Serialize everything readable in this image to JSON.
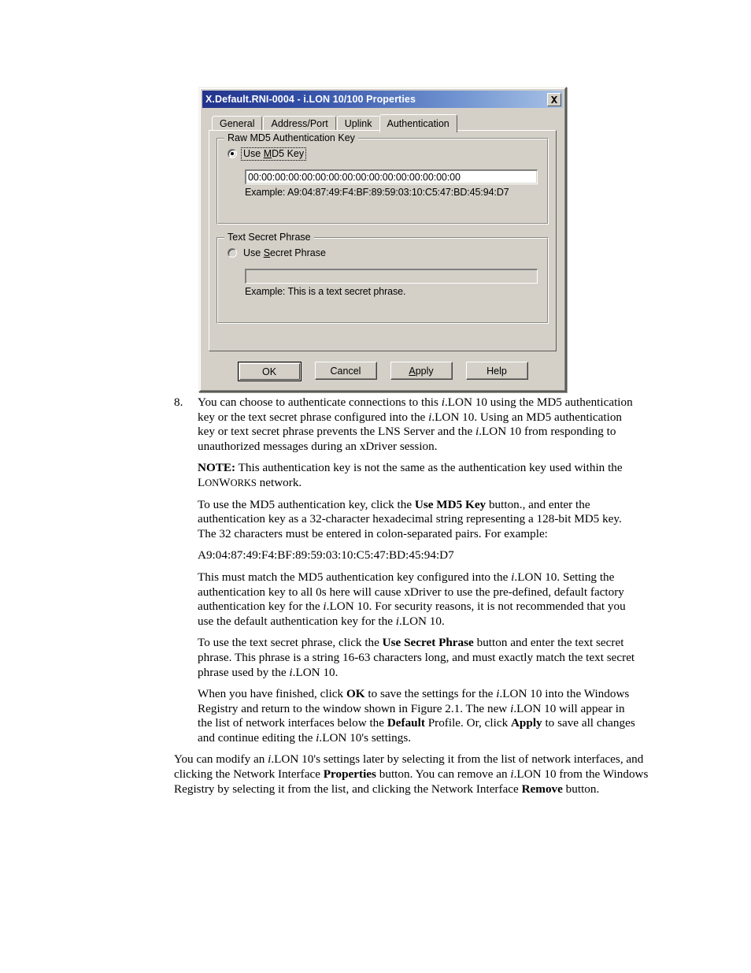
{
  "dialog": {
    "title": "X.Default.RNI-0004 - i.LON 10/100 Properties",
    "close_icon": "close-icon",
    "tabs": [
      {
        "label": "General",
        "active": false
      },
      {
        "label": "Address/Port",
        "active": false
      },
      {
        "label": "Uplink",
        "active": false
      },
      {
        "label": "Authentication",
        "active": true
      }
    ],
    "md5_group": {
      "title": "Raw MD5 Authentication Key",
      "radio_label_pre": "Use ",
      "radio_label_acc": "M",
      "radio_label_post": "D5 Key",
      "radio_selected": true,
      "key_value": "00:00:00:00:00:00:00:00:00:00:00:00:00:00:00:00",
      "example": "Example: A9:04:87:49:F4:BF:89:59:03:10:C5:47:BD:45:94:D7"
    },
    "phrase_group": {
      "title": "Text Secret Phrase",
      "radio_label_pre": "Use ",
      "radio_label_acc": "S",
      "radio_label_post": "ecret Phrase",
      "radio_selected": false,
      "phrase_value": "",
      "example": "Example: This is a text secret phrase."
    },
    "buttons": [
      {
        "label": "OK",
        "default": true
      },
      {
        "label": "Cancel",
        "default": false
      },
      {
        "label": "Apply",
        "default": false,
        "accel": "A"
      },
      {
        "label": "Help",
        "default": false
      }
    ],
    "colors": {
      "face": "#d4d0c8",
      "title_gradient_start": "#22338c",
      "title_gradient_end": "#a8c2e6",
      "field_background": "#ffffff"
    }
  },
  "document": {
    "step_number": "8.",
    "step_p1_a": "You can choose to authenticate connections to this ",
    "step_p1_i1": "i",
    "step_p1_b": ".LON 10 using the MD5 authentication key or the text secret phrase configured into the ",
    "step_p1_i2": "i",
    "step_p1_c": ".LON 10. Using an MD5 authentication key or text secret phrase prevents the LNS Server and the ",
    "step_p1_i3": "i",
    "step_p1_d": ".LON 10 from responding to unauthorized messages during an xDriver session.",
    "note_label": "NOTE:",
    "note_text_a": " This authentication key is not the same as the authentication key used within the ",
    "note_lonworks_l": "L",
    "note_lonworks_on": "ON",
    "note_lonworks_w": "W",
    "note_lonworks_orks": "ORKS",
    "note_text_b": " network.",
    "md5_para_a": "To use the MD5 authentication key, click the ",
    "md5_para_bold": "Use MD5 Key",
    "md5_para_b": " button., and enter the authentication key as a 32-character hexadecimal string representing a 128-bit MD5 key. The 32 characters must be entered in colon-separated pairs. For example:",
    "hex_example": "A9:04:87:49:F4:BF:89:59:03:10:C5:47:BD:45:94:D7",
    "match_para_a": "This must match the MD5 authentication key configured into the ",
    "match_i1": "i",
    "match_para_b": ".LON 10. Setting the authentication key to all 0s here will cause xDriver to use the pre-defined, default factory authentication key for the ",
    "match_i2": "i",
    "match_para_c": ".LON 10. For security reasons, it is not recommended that you use the default authentication key for the ",
    "match_i3": "i",
    "match_para_d": ".LON 10.",
    "phrase_para_a": "To use the text secret phrase, click the ",
    "phrase_para_bold": "Use Secret Phrase",
    "phrase_para_b": " button and enter the text secret phrase. This phrase is a string 16-63 characters long, and must exactly match the text secret phrase used by the ",
    "phrase_i1": "i",
    "phrase_para_c": ".LON 10.",
    "finish_a": "When you have finished, click ",
    "finish_ok": "OK",
    "finish_b": " to save the settings for the ",
    "finish_i1": "i",
    "finish_c": ".LON 10 into the Windows Registry and return to the window shown in Figure 2.1. The new ",
    "finish_i2": "i",
    "finish_d": ".LON 10 will appear in the list of network interfaces below the ",
    "finish_default": "Default",
    "finish_e": " Profile. Or, click ",
    "finish_apply": "Apply",
    "finish_f": " to save all changes and continue editing the ",
    "finish_i3": "i",
    "finish_g": ".LON 10's settings.",
    "modify_a": "You can modify an ",
    "modify_i1": "i",
    "modify_b": ".LON 10's settings later by selecting it from the list of network interfaces, and clicking the Network Interface ",
    "modify_properties": "Properties",
    "modify_c": " button. You can remove an ",
    "modify_i2": "i",
    "modify_d": ".LON 10 from the Windows Registry by selecting it from the list, and clicking the Network Interface ",
    "modify_remove": "Remove",
    "modify_e": " button."
  }
}
